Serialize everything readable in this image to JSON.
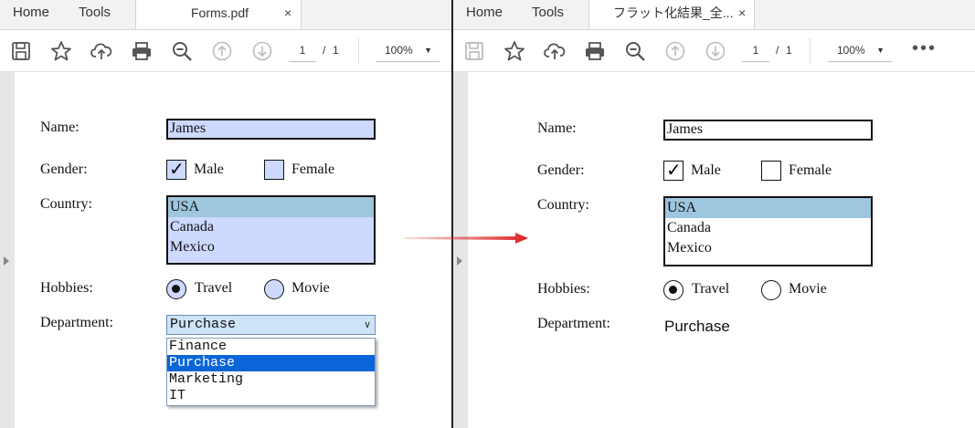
{
  "left": {
    "tabs": {
      "home": "Home",
      "tools": "Tools",
      "doc_title": "Forms.pdf",
      "close": "×"
    },
    "toolbar": {
      "page_current": "1",
      "page_sep": "/",
      "page_total": "1",
      "zoom": "100%"
    },
    "form": {
      "name_label": "Name:",
      "name_value": "James",
      "gender_label": "Gender:",
      "gender_options": [
        "Male",
        "Female"
      ],
      "gender_checked": "Male",
      "country_label": "Country:",
      "country_options": [
        "USA",
        "Canada",
        "Mexico"
      ],
      "country_selected": "USA",
      "hobbies_label": "Hobbies:",
      "hobby_options": [
        "Travel",
        "Movie"
      ],
      "hobby_selected": "Travel",
      "department_label": "Department:",
      "department_value": "Purchase",
      "department_options": [
        "Finance",
        "Purchase",
        "Marketing",
        "IT"
      ],
      "field_fill": "#cdd9ff",
      "check_mark": "✓"
    }
  },
  "right": {
    "tabs": {
      "home": "Home",
      "tools": "Tools",
      "doc_title": "フラット化結果_全...",
      "close": "×"
    },
    "toolbar": {
      "page_current": "1",
      "page_sep": "/",
      "page_total": "1",
      "zoom": "100%",
      "more": "•••"
    },
    "form": {
      "name_label": "Name:",
      "name_value": "James",
      "gender_label": "Gender:",
      "gender_options": [
        "Male",
        "Female"
      ],
      "gender_checked": "Male",
      "country_label": "Country:",
      "country_options": [
        "USA",
        "Canada",
        "Mexico"
      ],
      "country_selected": "USA",
      "hobbies_label": "Hobbies:",
      "hobby_options": [
        "Travel",
        "Movie"
      ],
      "hobby_selected": "Travel",
      "department_label": "Department:",
      "department_value": "Purchase",
      "check_mark": "✓"
    }
  },
  "arrow_color": "#e02020",
  "icons": [
    "save-icon",
    "star-icon",
    "cloud-upload-icon",
    "print-icon",
    "zoom-out-icon",
    "page-up-icon",
    "page-down-icon",
    "more-icon",
    "expand-panel-icon"
  ]
}
